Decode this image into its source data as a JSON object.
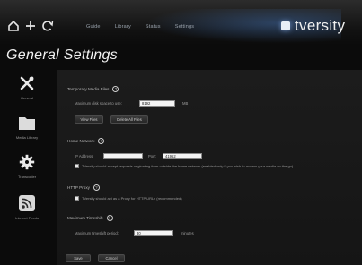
{
  "nav": {
    "home_icon": "home-icon",
    "add_icon": "add-icon",
    "refresh_icon": "refresh-icon",
    "links": [
      "Guide",
      "Library",
      "Status",
      "Settings"
    ]
  },
  "brand": {
    "name": "tversity"
  },
  "page_title": "General Settings",
  "sidebar": {
    "items": [
      {
        "label": "General",
        "icon": "tools-icon"
      },
      {
        "label": "Media Library",
        "icon": "folder-icon"
      },
      {
        "label": "Transcoder",
        "icon": "gear-icon"
      },
      {
        "label": "Internet Feeds",
        "icon": "rss-icon"
      }
    ]
  },
  "temp_files": {
    "title": "Temporary Media Files",
    "max_disk_label": "Maximum disk space to use:",
    "max_disk_value": "8192",
    "max_disk_unit": "MB",
    "view_files": "View Files",
    "delete_files": "Delete All Files"
  },
  "home_network": {
    "title": "Home Network",
    "ip_label": "IP Address:",
    "ip_value": "",
    "port_label": "Port:",
    "port_value": "41952",
    "reject_label": "TVersity should accept requests originating from outside the home network (enabled only if you wish to access your media on the go)",
    "reject_checked": false
  },
  "http_proxy": {
    "title": "HTTP Proxy",
    "proxy_label": "TVersity should act as a Proxy for HTTP URLs (recommended)",
    "proxy_checked": false
  },
  "max_timeshift": {
    "title": "Maximum Timeshift",
    "period_label": "Maximum timeshift period:",
    "period_value": "30",
    "period_unit": "minutes"
  },
  "footer": {
    "save": "Save",
    "cancel": "Cancel"
  }
}
